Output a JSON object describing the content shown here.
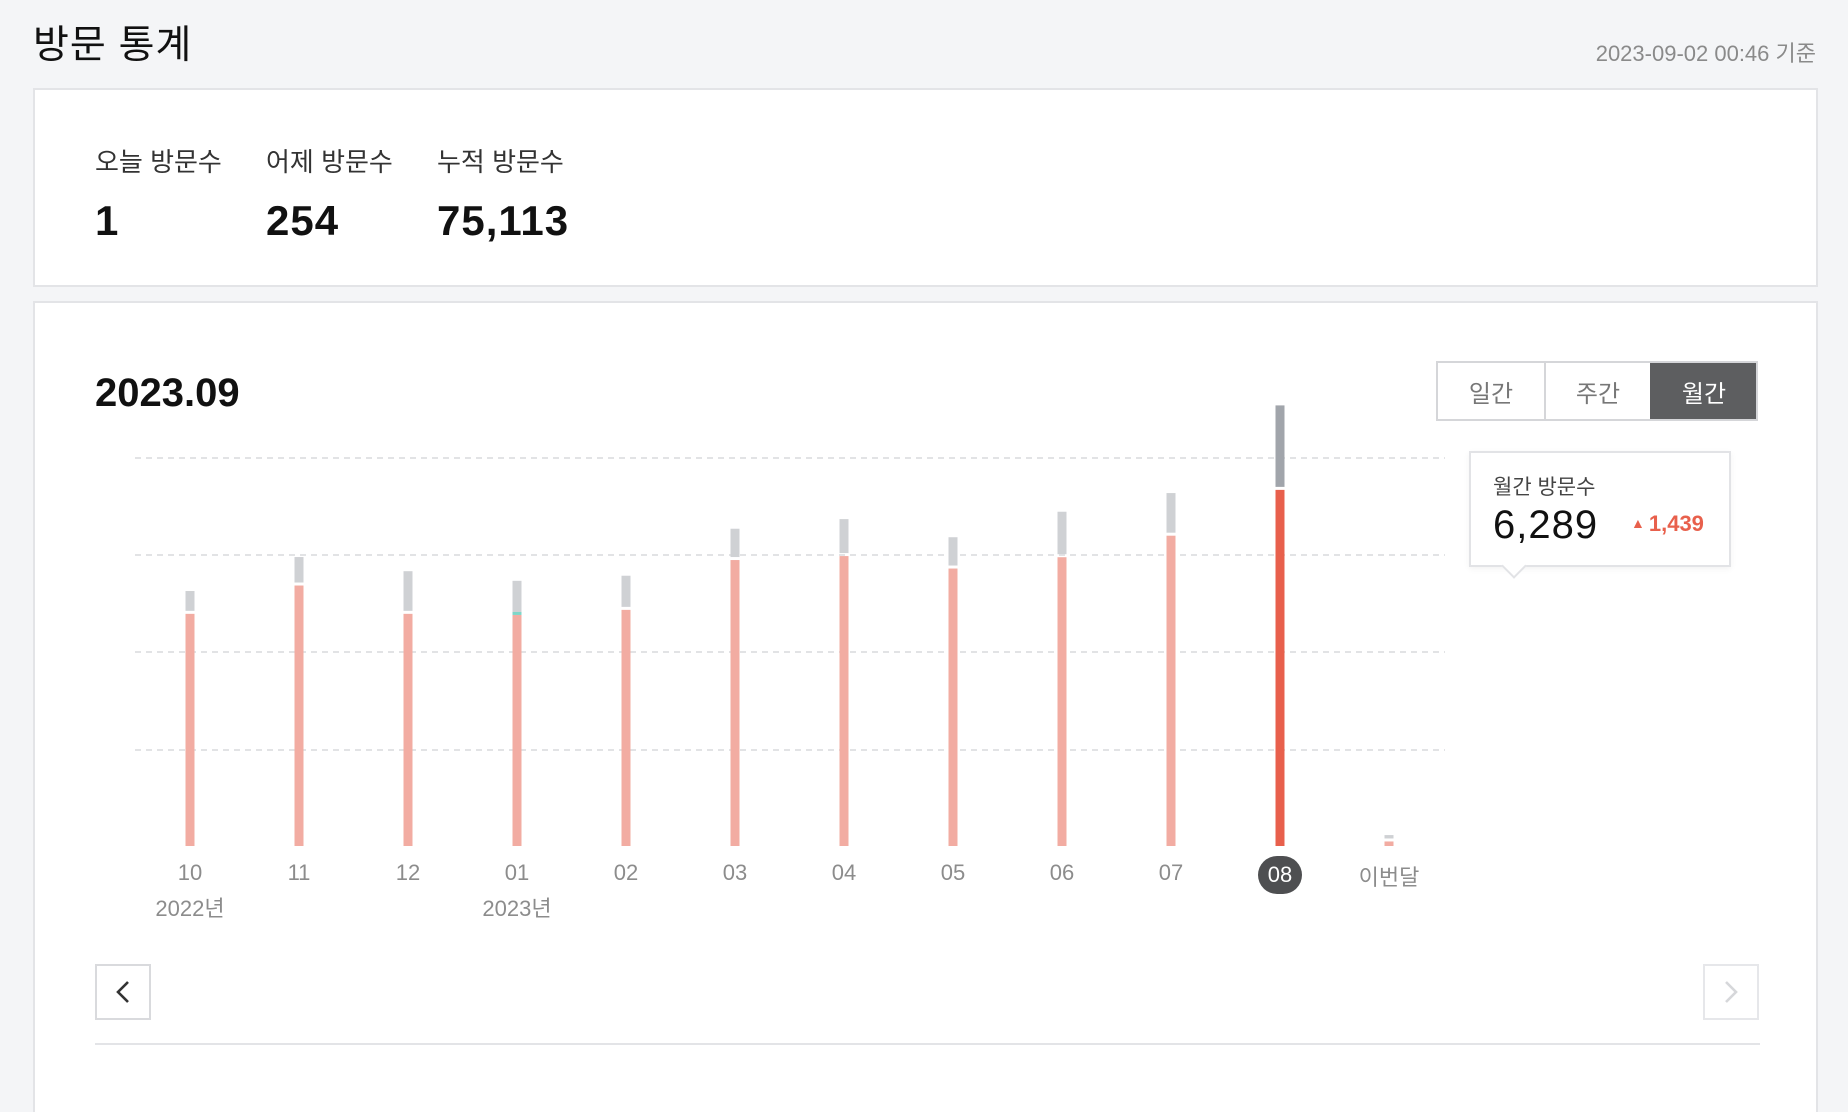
{
  "header": {
    "title": "방문 통계",
    "timestamp": "2023-09-02 00:46 기준"
  },
  "summary": {
    "stats": [
      {
        "label": "오늘 방문수",
        "value": "1"
      },
      {
        "label": "어제 방문수",
        "value": "254"
      },
      {
        "label": "누적 방문수",
        "value": "75,113"
      }
    ]
  },
  "chart_section": {
    "title": "2023.09",
    "toggle": [
      {
        "label": "일간",
        "active": false
      },
      {
        "label": "주간",
        "active": false
      },
      {
        "label": "월간",
        "active": true
      }
    ],
    "tooltip": {
      "label": "월간 방문수",
      "value": "6,289",
      "change": "1,439"
    }
  },
  "colors": {
    "bar_main": "#f2aca2",
    "bar_highlight": "#e8604c",
    "bar_top": "#cfd1d4",
    "bar_top_highlight": "#a1a5ab",
    "accent_teal": "#7fd6c8",
    "active_dark": "#4e4f51"
  },
  "chart_data": {
    "type": "bar",
    "categories": [
      "10",
      "11",
      "12",
      "01",
      "02",
      "03",
      "04",
      "05",
      "06",
      "07",
      "08",
      "이번달"
    ],
    "year_labels": [
      {
        "index": 0,
        "label": "2022년"
      },
      {
        "index": 3,
        "label": "2023년"
      }
    ],
    "series": [
      {
        "values": [
          4100,
          4600,
          4100,
          4080,
          4170,
          5050,
          5120,
          4900,
          5100,
          5480,
          6289,
          80
        ]
      },
      {
        "values": [
          350,
          450,
          700,
          550,
          550,
          500,
          600,
          500,
          750,
          700,
          1439,
          60
        ]
      }
    ],
    "highlight_index": 10,
    "ylim": [
      0,
      8000
    ],
    "grid": true
  }
}
